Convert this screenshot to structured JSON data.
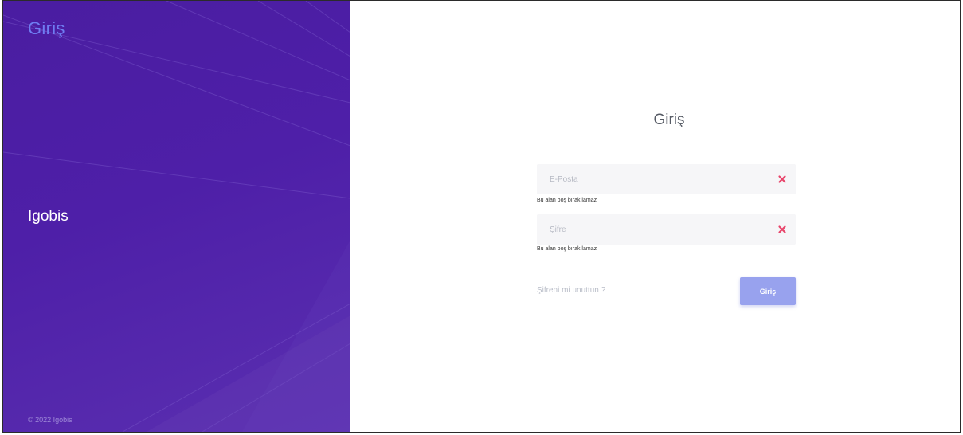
{
  "sidebar": {
    "title": "Giriş",
    "company_name": "Igobis",
    "copyright": "© 2022 Igobis"
  },
  "login_form": {
    "heading": "Giriş",
    "email": {
      "placeholder": "E-Posta",
      "value": "",
      "error": "Bu alan boş bırakılamaz"
    },
    "password": {
      "placeholder": "Şifre",
      "value": "",
      "error": "Bu alan boş bırakılamaz"
    },
    "forgot_password_label": "Şifreni mi unuttun ?",
    "submit_label": "Giriş"
  },
  "colors": {
    "sidebar_background": "#4e1fa8",
    "brand_title": "#6f7df2",
    "error_icon": "#e8456b",
    "submit_button": "#98a2ee"
  },
  "icons": {
    "field_status": "close-icon"
  }
}
